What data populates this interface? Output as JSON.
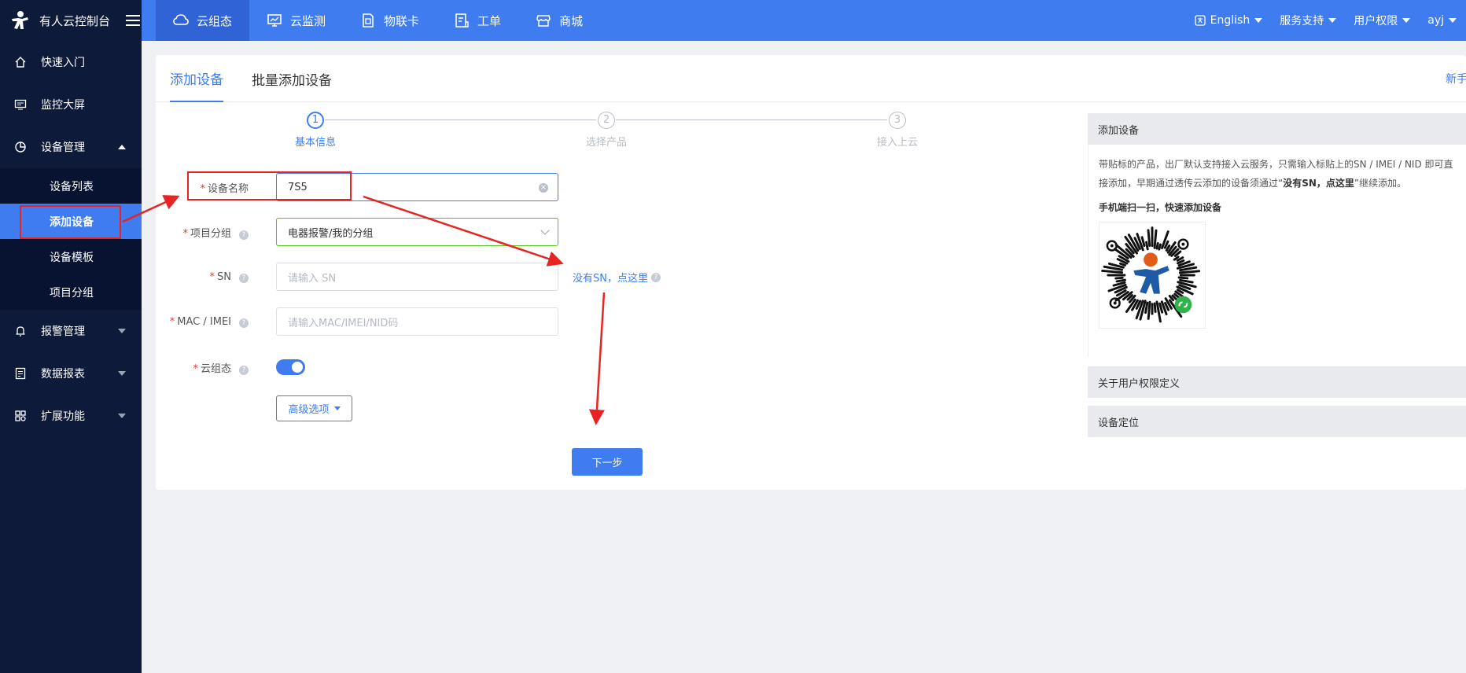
{
  "topbar": {
    "brand_title": "有人云控制台",
    "nav": [
      {
        "label": "云组态",
        "icon": "cloud-icon",
        "active": true
      },
      {
        "label": "云监测",
        "icon": "monitor-icon",
        "active": false
      },
      {
        "label": "物联卡",
        "icon": "sim-card-icon",
        "active": false
      },
      {
        "label": "工单",
        "icon": "ticket-icon",
        "active": false
      },
      {
        "label": "商城",
        "icon": "store-icon",
        "active": false
      }
    ],
    "right": {
      "language": "English",
      "support": "服务支持",
      "permissions": "用户权限",
      "user": "ayj"
    }
  },
  "sidebar": {
    "items": [
      {
        "label": "快速入门",
        "icon": "home-icon"
      },
      {
        "label": "监控大屏",
        "icon": "screen-icon"
      },
      {
        "label": "设备管理",
        "icon": "device-icon",
        "expanded": true
      },
      {
        "label": "报警管理",
        "icon": "bell-icon"
      },
      {
        "label": "数据报表",
        "icon": "report-icon"
      },
      {
        "label": "扩展功能",
        "icon": "grid-icon"
      }
    ],
    "device_sub": [
      "设备列表",
      "添加设备",
      "设备模板",
      "项目分组"
    ],
    "active_sub": "添加设备"
  },
  "tabs": [
    "添加设备",
    "批量添加设备"
  ],
  "guide_link": "新手",
  "steps": [
    {
      "num": "1",
      "label": "基本信息",
      "active": true
    },
    {
      "num": "2",
      "label": "选择产品",
      "active": false
    },
    {
      "num": "3",
      "label": "接入上云",
      "active": false
    }
  ],
  "form": {
    "device_name": {
      "label": "设备名称",
      "value": "7S5"
    },
    "project_group": {
      "label": "项目分组",
      "value": "电器报警/我的分组"
    },
    "sn": {
      "label": "SN",
      "placeholder": "请输入 SN"
    },
    "mac": {
      "label": "MAC / IMEI",
      "placeholder": "请输入MAC/IMEI/NID码"
    },
    "cloud_config": {
      "label": "云组态",
      "enabled": true
    },
    "no_sn_link": "没有SN，点这里",
    "advanced_button": "高级选项",
    "next_button": "下一步"
  },
  "help_panel": {
    "title": "添加设备",
    "text_line1": "带贴标的产品，出厂默认支持接入云服务，只需输入标贴上的SN / IMEI / NID 即可直",
    "text_line2_a": "接添加，早期通过透传云添加的设备须通过“",
    "text_line2_b": "没有SN，点这里",
    "text_line2_c": "”继续添加。",
    "qr_title": "手机端扫一扫，快速添加设备",
    "section_permissions": "关于用户权限定义",
    "section_location": "设备定位"
  },
  "colors": {
    "primary": "#3e7cf0",
    "sidebar_bg": "#0d1a3a",
    "annotation_red": "#e82323"
  }
}
